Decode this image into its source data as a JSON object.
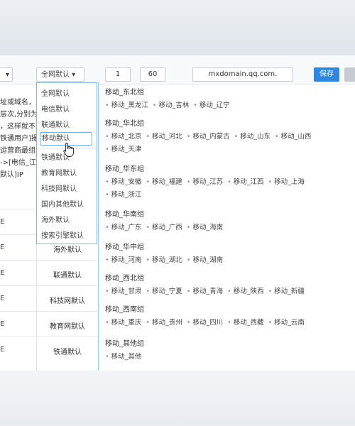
{
  "toolbar": {
    "left_select": "▾",
    "line_select": "全网默认 ▾",
    "weight": "1",
    "ttl": "60",
    "domain": "mxdomain.qq.com.",
    "save": "保存"
  },
  "left_text_lines": [
    "址或域名，",
    "层次,分别为",
    "，这样就不",
    "铁通用户]撮",
    "运营商最组",
    "->[电信_江",
    "默认]IP"
  ],
  "table_rows": [
    {
      "c1": "E",
      "c2": ""
    },
    {
      "c1": "E",
      "c2": "海外默认"
    },
    {
      "c1": "E",
      "c2": "联通默认"
    },
    {
      "c1": "E",
      "c2": "科技网默认"
    },
    {
      "c1": "E",
      "c2": "教育网默认"
    },
    {
      "c1": "E",
      "c2": "铁通默认"
    }
  ],
  "dropdown": {
    "items": [
      "全网默认",
      "电信默认",
      "联通默认",
      "移动默认",
      "铁通默认",
      "教育网默认",
      "科技网默认",
      "国内其他默认",
      "海外默认",
      "搜索引擎默认"
    ],
    "selected_index": 3
  },
  "groups": [
    {
      "title": "移动_东北组",
      "lines": [
        [
          "移动_黑龙江",
          "移动_吉林",
          "移动_辽宁"
        ]
      ]
    },
    {
      "title": "移动_华北组",
      "lines": [
        [
          "移动_北京",
          "移动_河北",
          "移动_内蒙古",
          "移动_山东",
          "移动_山西"
        ],
        [
          "移动_天津"
        ]
      ]
    },
    {
      "title": "移动_华东组",
      "lines": [
        [
          "移动_安徽",
          "移动_福建",
          "移动_江苏",
          "移动_江西",
          "移动_上海"
        ],
        [
          "移动_浙江"
        ]
      ]
    },
    {
      "title": "移动_华南组",
      "lines": [
        [
          "移动_广东",
          "移动_广西",
          "移动_海南"
        ]
      ]
    },
    {
      "title": "移动_华中组",
      "lines": [
        [
          "移动_河南",
          "移动_湖北",
          "移动_湖南"
        ]
      ]
    },
    {
      "title": "移动_西北组",
      "lines": [
        [
          "移动_甘肃",
          "移动_宁夏",
          "移动_青海",
          "移动_陕西",
          "移动_新疆"
        ]
      ]
    },
    {
      "title": "移动_西南组",
      "lines": [
        [
          "移动_重庆",
          "移动_贵州",
          "移动_四川",
          "移动_西藏",
          "移动_云南"
        ]
      ]
    },
    {
      "title": "移动_其他组",
      "lines": [
        [
          "移动_其他"
        ]
      ]
    }
  ],
  "colors": {
    "accent": "#2f86e0",
    "border_focus": "#7cb6ec"
  }
}
